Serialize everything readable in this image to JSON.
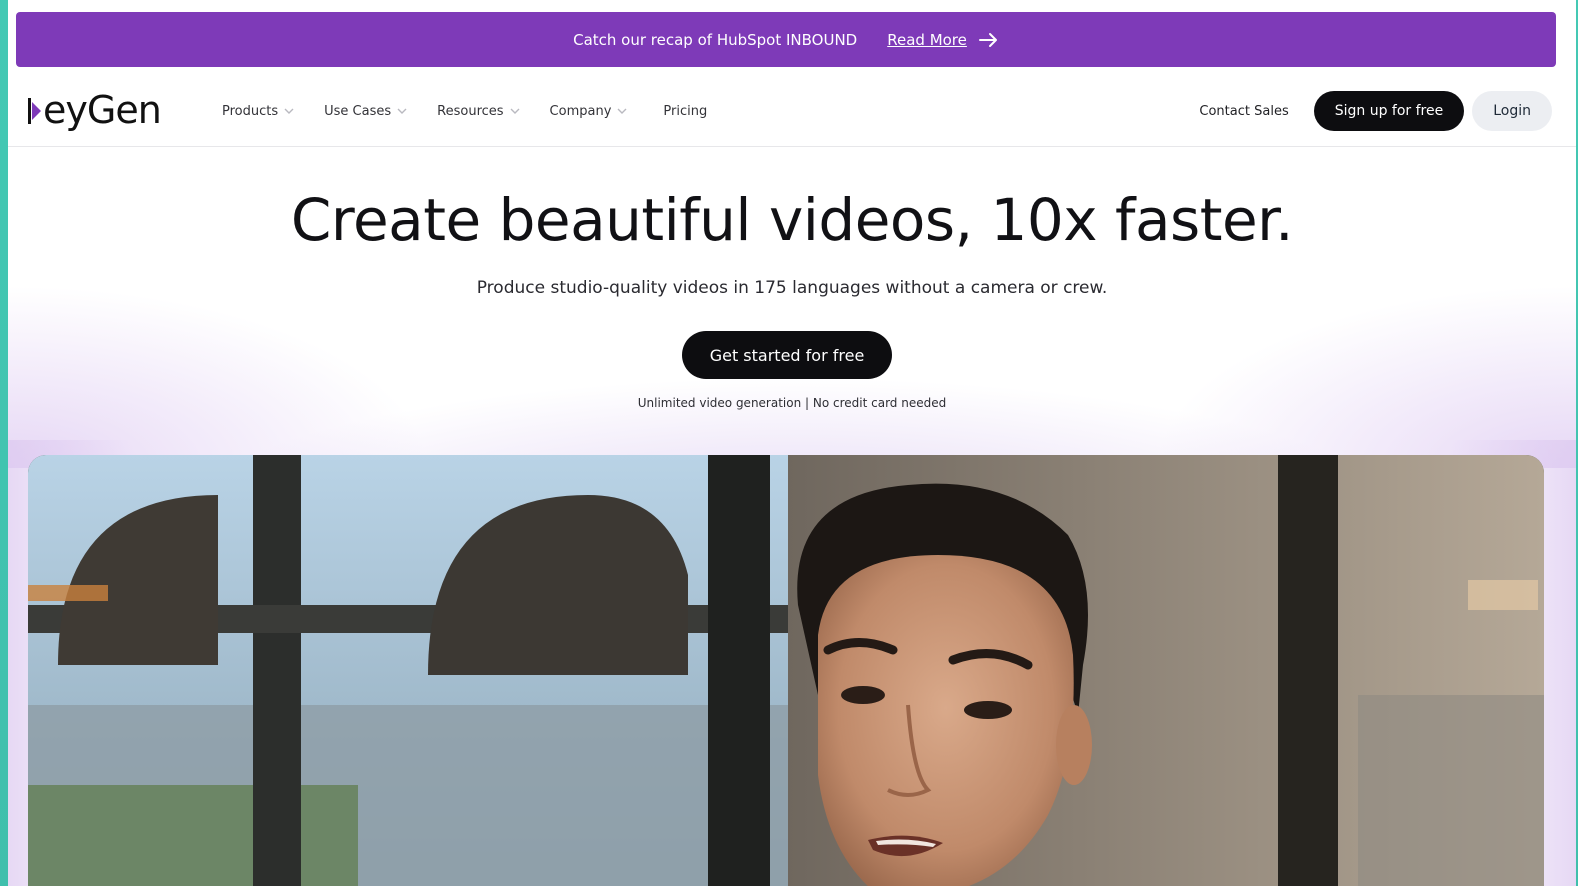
{
  "announcement": {
    "text": "Catch our recap of HubSpot INBOUND",
    "link_label": "Read More",
    "icon": "arrow-right-icon"
  },
  "header": {
    "logo_text": "eyGen",
    "logo_prefix": "H",
    "nav": [
      {
        "label": "Products",
        "has_dropdown": true
      },
      {
        "label": "Use Cases",
        "has_dropdown": true
      },
      {
        "label": "Resources",
        "has_dropdown": true
      },
      {
        "label": "Company",
        "has_dropdown": true
      },
      {
        "label": "Pricing",
        "has_dropdown": false
      }
    ],
    "contact_label": "Contact Sales",
    "signup_label": "Sign up for free",
    "login_label": "Login"
  },
  "hero": {
    "title": "Create beautiful videos, 10x faster.",
    "subtitle": "Produce studio-quality videos in 175 languages without a camera or crew.",
    "cta_label": "Get started for free",
    "note": "Unlimited video generation | No credit card needed"
  },
  "colors": {
    "accent_purple": "#7e3ab8",
    "button_dark": "#0d0d10",
    "login_bg": "#eceef2",
    "page_border": "#44c9b4"
  }
}
